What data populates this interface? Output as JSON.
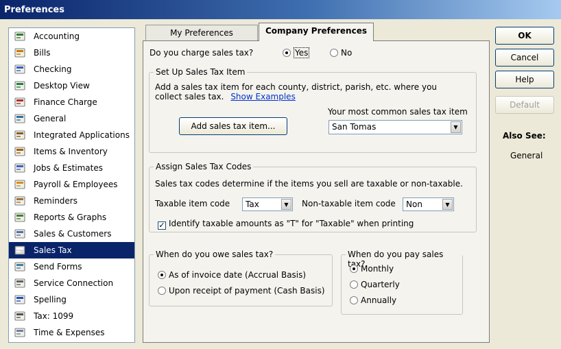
{
  "window": {
    "title": "Preferences"
  },
  "sidebar": {
    "items": [
      {
        "label": "Accounting",
        "icon": "accounting-icon"
      },
      {
        "label": "Bills",
        "icon": "bills-icon"
      },
      {
        "label": "Checking",
        "icon": "checking-icon"
      },
      {
        "label": "Desktop View",
        "icon": "desktop-view-icon"
      },
      {
        "label": "Finance Charge",
        "icon": "finance-charge-icon"
      },
      {
        "label": "General",
        "icon": "general-icon"
      },
      {
        "label": "Integrated Applications",
        "icon": "integrated-applications-icon"
      },
      {
        "label": "Items & Inventory",
        "icon": "items-inventory-icon"
      },
      {
        "label": "Jobs & Estimates",
        "icon": "jobs-estimates-icon"
      },
      {
        "label": "Payroll & Employees",
        "icon": "payroll-employees-icon"
      },
      {
        "label": "Reminders",
        "icon": "reminders-icon"
      },
      {
        "label": "Reports & Graphs",
        "icon": "reports-graphs-icon"
      },
      {
        "label": "Sales & Customers",
        "icon": "sales-customers-icon"
      },
      {
        "label": "Sales Tax",
        "icon": "sales-tax-icon"
      },
      {
        "label": "Send Forms",
        "icon": "send-forms-icon"
      },
      {
        "label": "Service Connection",
        "icon": "service-connection-icon"
      },
      {
        "label": "Spelling",
        "icon": "spelling-icon"
      },
      {
        "label": "Tax: 1099",
        "icon": "tax-1099-icon"
      },
      {
        "label": "Time & Expenses",
        "icon": "time-expenses-icon"
      }
    ],
    "selected_index": 13
  },
  "tabs": {
    "my_preferences": "My Preferences",
    "company_preferences": "Company Preferences"
  },
  "sales_tax": {
    "charge_question": "Do you charge sales tax?",
    "yes_label": "Yes",
    "no_label": "No",
    "charge_value": "Yes"
  },
  "setup_item": {
    "title": "Set Up Sales Tax Item",
    "description_line1": "Add a sales tax item for each county, district, parish, etc. where you",
    "description_line2": "collect sales tax.",
    "show_examples": "Show Examples",
    "common_item_label": "Your most common sales tax item",
    "common_item_value": "San Tomas",
    "add_button": "Add sales tax item..."
  },
  "tax_codes": {
    "title": "Assign Sales Tax Codes",
    "description": "Sales tax codes determine if the items you sell are taxable or non-taxable.",
    "taxable_label": "Taxable item code",
    "taxable_value": "Tax",
    "nontaxable_label": "Non-taxable item code",
    "nontaxable_value": "Non",
    "identify_label": "Identify taxable amounts as \"T\" for \"Taxable\" when printing",
    "identify_checked": true
  },
  "owe": {
    "title": "When do you owe sales tax?",
    "option1": "As of invoice date (Accrual Basis)",
    "option2": "Upon receipt of payment (Cash Basis)",
    "selected": "option1"
  },
  "pay": {
    "title": "When do you pay sales tax?",
    "monthly": "Monthly",
    "quarterly": "Quarterly",
    "annually": "Annually",
    "selected": "monthly"
  },
  "buttons": {
    "ok": "OK",
    "cancel": "Cancel",
    "help": "Help",
    "default": "Default"
  },
  "also_see": {
    "title": "Also See:",
    "link": "General"
  },
  "colors": {
    "title_bar": "#0a246a",
    "selection": "#0a246a",
    "link": "#0033cc"
  }
}
